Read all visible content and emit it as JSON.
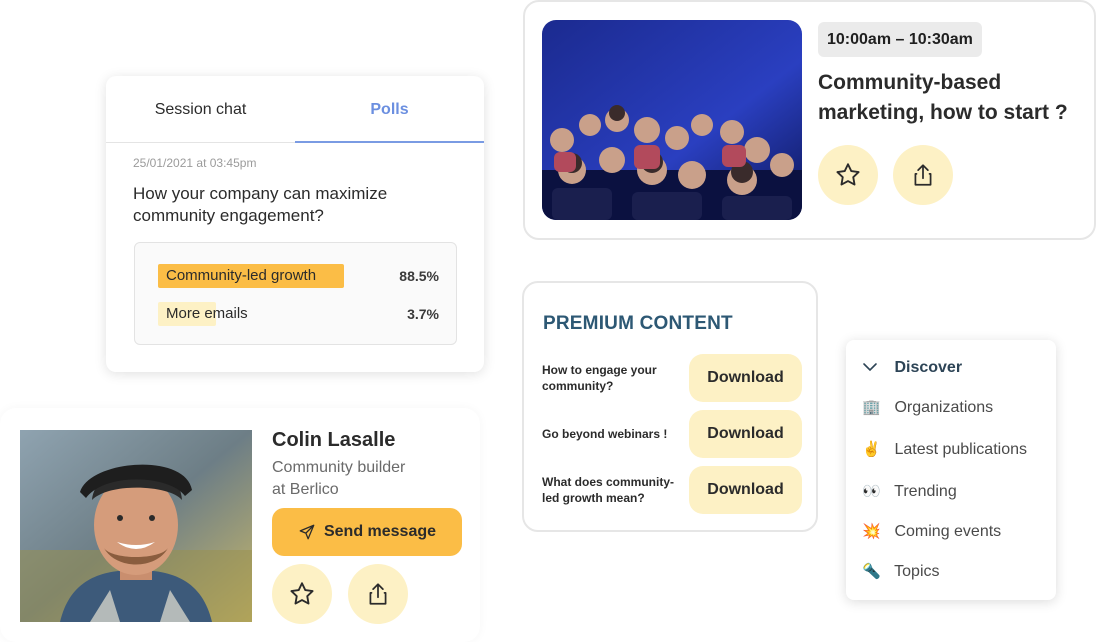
{
  "session": {
    "time": "10:00am – 10:30am",
    "title": "Community-based marketing, how to start ?"
  },
  "poll": {
    "tabs": [
      "Session chat",
      "Polls"
    ],
    "active_tab": "Polls",
    "date": "25/01/2021 at 03:45pm",
    "question": "How your company can maximize community engagement?",
    "options": [
      {
        "label": "Community-led growth",
        "percent": "88.5%",
        "fill": 0.885,
        "color": "#fbbd46"
      },
      {
        "label": "More emails",
        "percent": "3.7%",
        "fill": 0.037,
        "color": "#fdf1c5"
      }
    ]
  },
  "premium": {
    "title": "PREMIUM CONTENT",
    "items": [
      {
        "label": "How to engage your community?",
        "button": "Download"
      },
      {
        "label": "Go beyond webinars !",
        "button": "Download"
      },
      {
        "label": "What does community-led growth mean?",
        "button": "Download"
      }
    ]
  },
  "discover": {
    "header": "Discover",
    "items": [
      {
        "emoji": "🏢",
        "label": "Organizations"
      },
      {
        "emoji": "✌️",
        "label": "Latest publications"
      },
      {
        "emoji": "👀",
        "label": "Trending"
      },
      {
        "emoji": "💥",
        "label": "Coming events"
      },
      {
        "emoji": "🔦",
        "label": "Topics"
      }
    ]
  },
  "profile": {
    "name": "Colin Lasalle",
    "role_line1": "Community builder",
    "role_line2": "at Berlico",
    "send_label": "Send message"
  },
  "colors": {
    "accent_yellow": "#fbbd46",
    "soft_yellow": "#fdf1c5",
    "polls_blue": "#6b8fe0",
    "premium_navy": "#2d5874"
  }
}
